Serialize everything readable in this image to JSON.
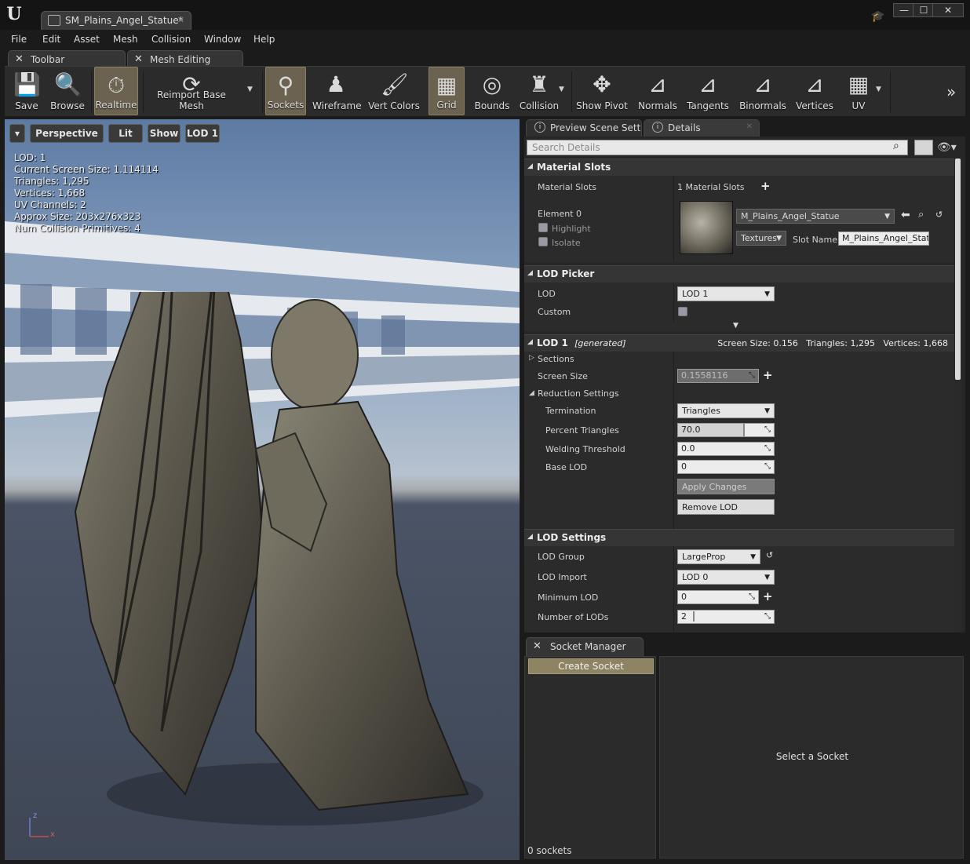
{
  "window": {
    "document_tab": "SM_Plains_Angel_Statue*",
    "min": "—",
    "max": "☐",
    "close": "✕"
  },
  "logo": "U",
  "menu": [
    "File",
    "Edit",
    "Asset",
    "Mesh",
    "Collision",
    "Window",
    "Help"
  ],
  "subtabs": [
    "Toolbar",
    "Mesh Editing"
  ],
  "toolbar": {
    "save": "Save",
    "browse": "Browse",
    "realtime": "Realtime",
    "reimport": "Reimport Base Mesh",
    "sockets": "Sockets",
    "wireframe": "Wireframe",
    "vert_colors": "Vert Colors",
    "grid": "Grid",
    "bounds": "Bounds",
    "collision": "Collision",
    "show_pivot": "Show Pivot",
    "normals": "Normals",
    "tangents": "Tangents",
    "binormals": "Binormals",
    "vertices": "Vertices",
    "uv": "UV"
  },
  "viewport": {
    "perspective": "Perspective",
    "lit": "Lit",
    "show": "Show",
    "lod": "LOD 1",
    "stats": [
      "LOD:  1",
      "Current Screen Size:  1.114114",
      "Triangles:  1,295",
      "Vertices:  1,668",
      "UV Channels:  2",
      "Approx Size: 203x276x323",
      "Num Collision Primitives:  4"
    ],
    "axis_z": "z",
    "axis_x": "x"
  },
  "details": {
    "tabs": [
      "Preview Scene Sett",
      "Details"
    ],
    "search_placeholder": "Search Details",
    "material_slots": {
      "header": "Material Slots",
      "label": "Material Slots",
      "count": "1 Material Slots",
      "element": "Element 0",
      "highlight": "Highlight",
      "isolate": "Isolate",
      "material": "M_Plains_Angel_Statue",
      "textures": "Textures",
      "slot_name_label": "Slot Name",
      "slot_name": "M_Plains_Angel_Stat"
    },
    "lod_picker": {
      "header": "LOD Picker",
      "lod_label": "LOD",
      "lod_value": "LOD 1",
      "custom_label": "Custom"
    },
    "lod1": {
      "header": "LOD 1",
      "generated": "[generated]",
      "summary": "Screen Size: 0.156   Triangles: 1,295   Vertices: 1,668",
      "sections": "Sections",
      "screen_size_label": "Screen Size",
      "screen_size": "0.1558116",
      "reduction": "Reduction Settings",
      "termination_label": "Termination",
      "termination": "Triangles",
      "percent_label": "Percent Triangles",
      "percent": "70.0",
      "percent_fraction": 0.7,
      "welding_label": "Welding Threshold",
      "welding": "0.0",
      "base_lod_label": "Base LOD",
      "base_lod": "0",
      "apply": "Apply Changes",
      "remove": "Remove LOD"
    },
    "lod_settings": {
      "header": "LOD Settings",
      "group_label": "LOD Group",
      "group": "LargeProp",
      "import_label": "LOD Import",
      "import": "LOD 0",
      "min_label": "Minimum LOD",
      "min": "0",
      "num_label": "Number of LODs",
      "num": "2"
    }
  },
  "socket_manager": {
    "tab": "Socket Manager",
    "create": "Create Socket",
    "count": "0 sockets",
    "hint": "Select a Socket"
  },
  "colors": {
    "accent_active": "#6b6350",
    "create_socket": "#8e8464",
    "panel": "#262626",
    "background": "#1b1b1b"
  }
}
